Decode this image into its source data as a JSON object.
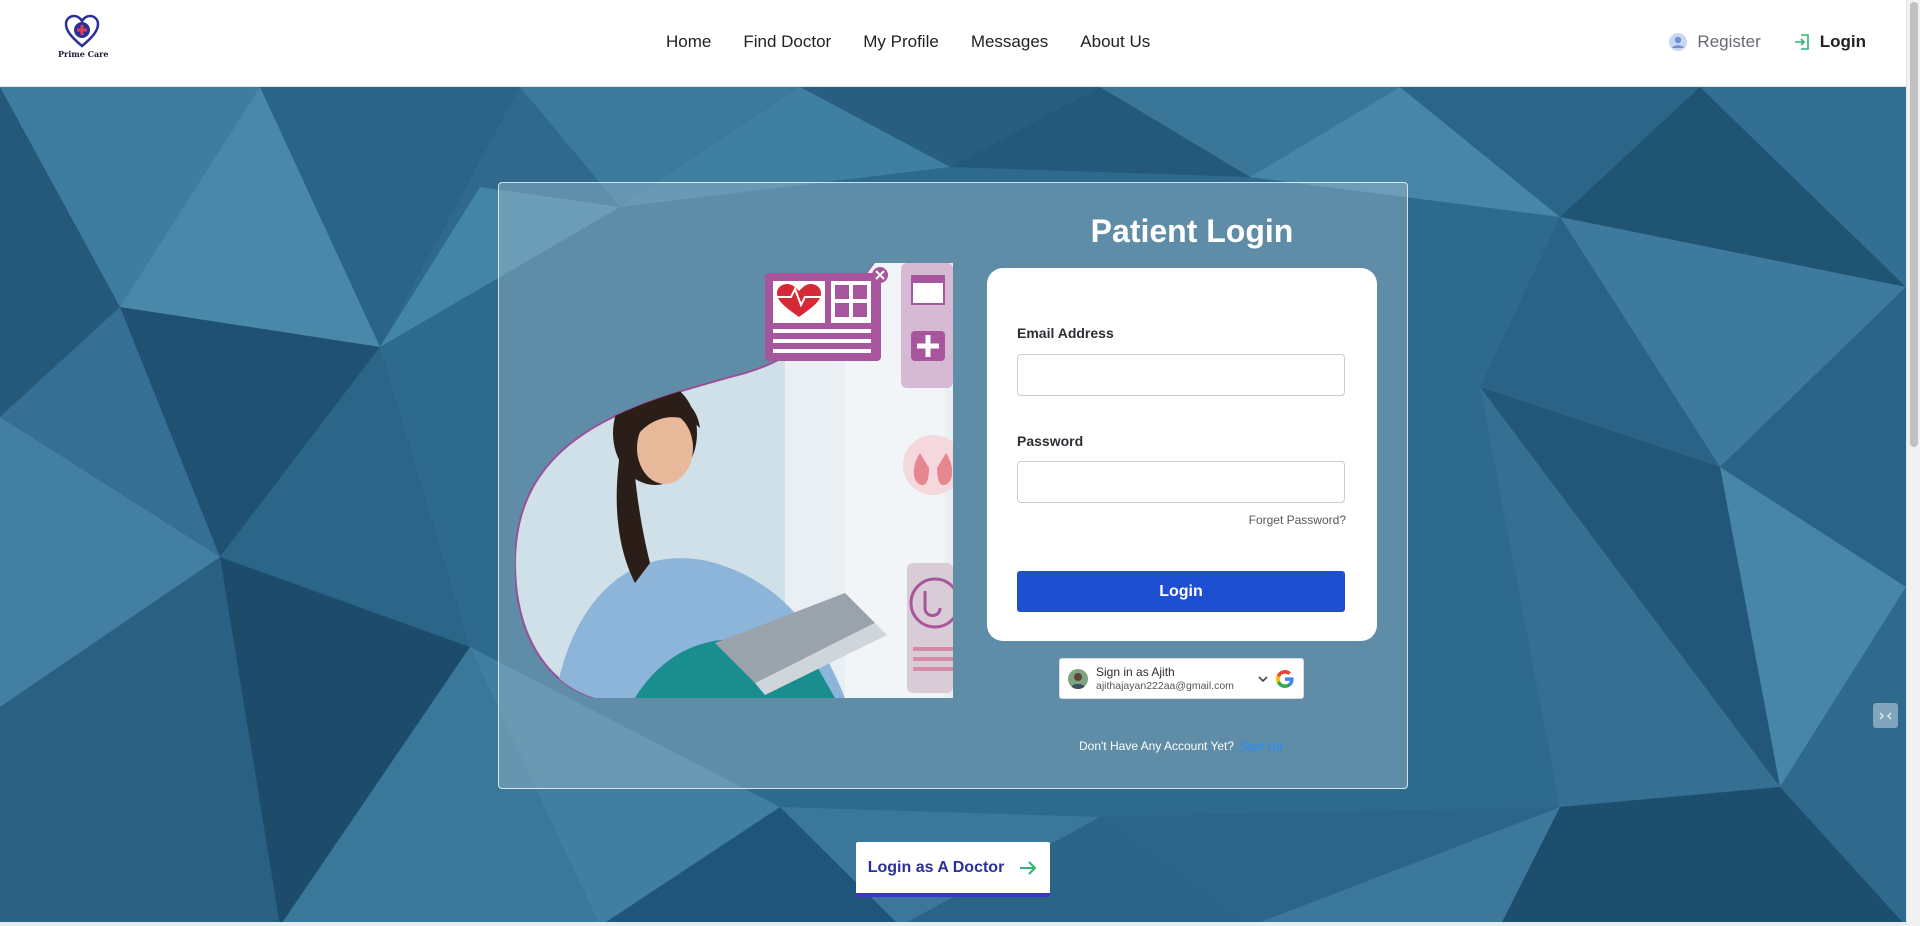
{
  "brand": {
    "name": "Prime Care",
    "accent": "#2a2f9a"
  },
  "nav": {
    "items": [
      {
        "label": "Home"
      },
      {
        "label": "Find Doctor"
      },
      {
        "label": "My Profile"
      },
      {
        "label": "Messages"
      },
      {
        "label": "About Us"
      }
    ]
  },
  "auth": {
    "register_label": "Register",
    "register_icon": "user-circle-icon",
    "login_label": "Login",
    "login_icon": "sign-in-icon"
  },
  "card": {
    "title": "Patient Login",
    "email_label": "Email Address",
    "email_value": "",
    "password_label": "Password",
    "password_value": "",
    "forget_label": "Forget Password?",
    "login_button": "Login",
    "google": {
      "name": "Sign in as Ajith",
      "email": "ajithajayan222aa@gmail.com"
    },
    "signup_prompt": "Don't Have Any Account Yet?",
    "signup_link": "Sign Up"
  },
  "doctor_button": {
    "label": "Login as A Doctor",
    "icon": "arrow-right-icon"
  },
  "colors": {
    "background": "#2f6a8c",
    "login_button": "#1f4fd1",
    "signup_link": "#1e8cff"
  }
}
